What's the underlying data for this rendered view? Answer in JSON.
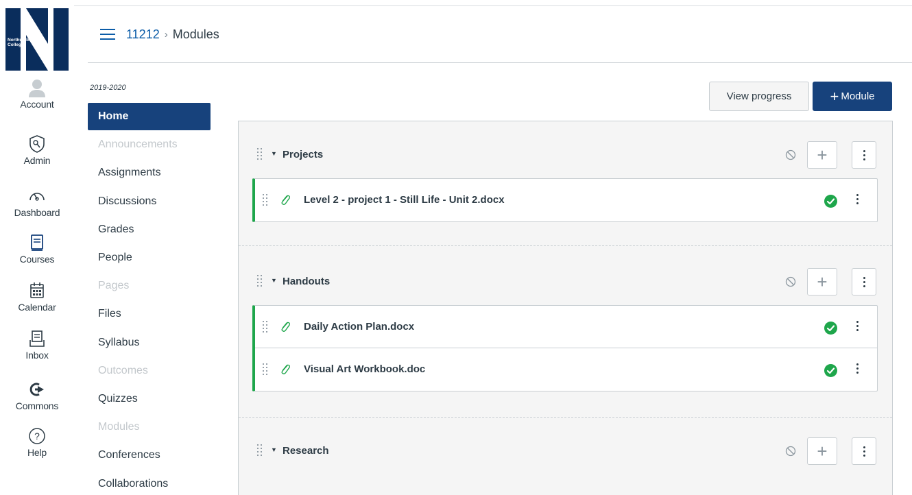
{
  "logo": {
    "text": "Northumberland\nCollege",
    "color": "#0a2d5c"
  },
  "global_nav": [
    {
      "label": "Account",
      "icon": "user-avatar-icon"
    },
    {
      "label": "Admin",
      "icon": "admin-shield-icon"
    },
    {
      "label": "Dashboard",
      "icon": "speedometer-icon"
    },
    {
      "label": "Courses",
      "icon": "book-icon"
    },
    {
      "label": "Calendar",
      "icon": "calendar-icon"
    },
    {
      "label": "Inbox",
      "icon": "inbox-icon"
    },
    {
      "label": "Commons",
      "icon": "commons-arrow-icon"
    },
    {
      "label": "Help",
      "icon": "help-question-icon"
    }
  ],
  "breadcrumb": {
    "course": "11212",
    "separator": "›",
    "current": "Modules"
  },
  "course_nav": {
    "term": "2019-2020",
    "items": [
      {
        "label": "Home",
        "state": "active"
      },
      {
        "label": "Announcements",
        "state": "disabled"
      },
      {
        "label": "Assignments",
        "state": "normal"
      },
      {
        "label": "Discussions",
        "state": "normal"
      },
      {
        "label": "Grades",
        "state": "normal"
      },
      {
        "label": "People",
        "state": "normal"
      },
      {
        "label": "Pages",
        "state": "disabled"
      },
      {
        "label": "Files",
        "state": "normal"
      },
      {
        "label": "Syllabus",
        "state": "normal"
      },
      {
        "label": "Outcomes",
        "state": "disabled"
      },
      {
        "label": "Quizzes",
        "state": "normal"
      },
      {
        "label": "Modules",
        "state": "disabled"
      },
      {
        "label": "Conferences",
        "state": "normal"
      },
      {
        "label": "Collaborations",
        "state": "normal"
      }
    ]
  },
  "toolbar": {
    "view_progress": "View progress",
    "add_module": "Module",
    "add_module_plus": "+"
  },
  "modules": [
    {
      "title": "Projects",
      "items": [
        {
          "title": "Level 2 - project 1 - Still Life - Unit 2.docx",
          "published": true
        }
      ]
    },
    {
      "title": "Handouts",
      "items": [
        {
          "title": "Daily Action Plan.docx",
          "published": true
        },
        {
          "title": "Visual Art Workbook.doc",
          "published": true
        }
      ]
    },
    {
      "title": "Research",
      "items": []
    }
  ],
  "colors": {
    "brand": "#17427c",
    "link": "#0b5ca8",
    "published": "#1ea64b",
    "disabled_text": "#c3c8cc"
  }
}
